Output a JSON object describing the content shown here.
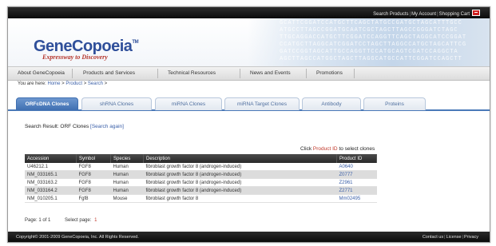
{
  "utility_bar": {
    "links": [
      "Search Products",
      "My Account",
      "Shopping Cart"
    ],
    "separator": "|",
    "cart_icon": "cart-icon"
  },
  "header": {
    "logo": "GeneCopoeia",
    "logo_tm": "TM",
    "tagline": "Expressway to Discovery",
    "dna_text": [
      "GCATTCGGATCCATGCTTCAGCTATGCCGATGCTAGCATTTGCC",
      "ATGCCTTAGCCGGATGCAATCGCTAGCTTAGCCGGGATCTAGC",
      "TTGCAGGACCATGCTTCGGATCCAGGTTCAGCTAGGCATCCGGAT",
      "CCATGCTTAGGCATCGGATCCTAGCTTAGGCCATGCTAGCATTCG",
      "GATCCGGTAGCATTGCCAGGTTCCATGCAGTCGATCCAGGCTA",
      "AGCTTAGCCATGGCTAGCTTAGGCATGCCATTCGGATCCAGCTT"
    ]
  },
  "main_nav": {
    "items": [
      "About GeneCopoeia",
      "Products and Services",
      "Technical Resources",
      "News and Events",
      "Promotions"
    ]
  },
  "breadcrumb": {
    "prefix": "You are here:",
    "items": [
      "Home",
      "Product",
      "Search"
    ],
    "separator": ">"
  },
  "tabs": {
    "items": [
      "ORFcDNA Clones",
      "shRNA Clones",
      "miRNA Clones",
      "miRNA Target Clones",
      "Antibody",
      "Proteins"
    ],
    "active": "ORFcDNA Clones"
  },
  "search_result": {
    "label": "Search Result: ORF Clones",
    "again_link": "[Search again]"
  },
  "click_hint": {
    "before": "Click",
    "highlight": "Product ID",
    "after": "to select clones"
  },
  "table": {
    "columns": [
      "Accession",
      "Symbol",
      "Species",
      "Description",
      "Product ID"
    ],
    "rows": [
      [
        "U46212.1",
        "FGF8",
        "Human",
        "fibroblast growth factor 8 (androgen-induced)",
        "A0640"
      ],
      [
        "NM_033165.1",
        "FGF8",
        "Human",
        "fibroblast growth factor 8 (androgen-induced)",
        "Z0777"
      ],
      [
        "NM_033163.2",
        "FGF8",
        "Human",
        "fibroblast growth factor 8 (androgen-induced)",
        "Z2961"
      ],
      [
        "NM_033164.2",
        "FGF8",
        "Human",
        "fibroblast growth factor 8 (androgen-induced)",
        "Z2771"
      ],
      [
        "NM_010205.1",
        "Fgf8",
        "Mouse",
        "fibroblast growth factor 8",
        "Mm02495"
      ]
    ]
  },
  "pager": {
    "page_text": "Page: 1 of 1",
    "select_label": "Select page:",
    "current_page": "1"
  },
  "footer": {
    "copyright": "Copyright© 2001-2009 GeneCopoeia, Inc. All Rights Reserved.",
    "links": [
      "Contact us",
      "License",
      "Privacy"
    ],
    "separator": "|"
  },
  "colors": {
    "brand_blue": "#2f4f9a",
    "tagline_red": "#b4332a",
    "active_tab": "#3f6fb1",
    "link_blue": "#3a5fa8",
    "highlight_red": "#c0392b"
  }
}
